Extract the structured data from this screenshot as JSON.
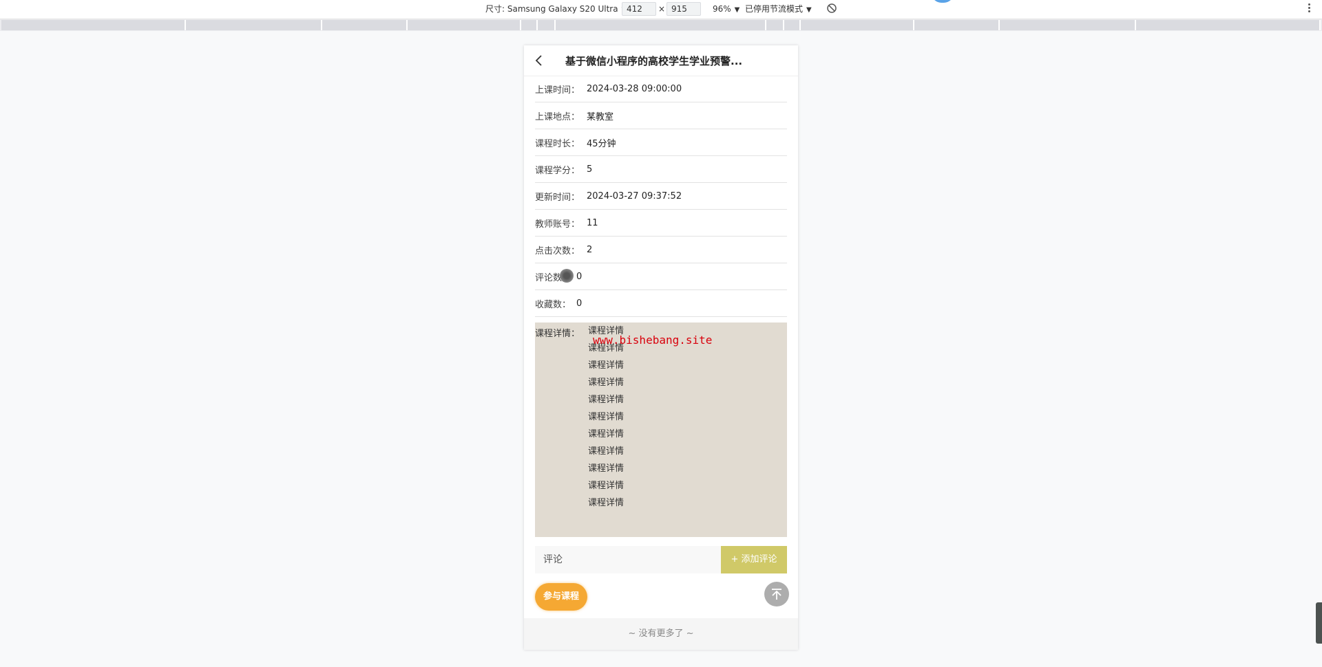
{
  "devtools": {
    "device_label": "尺寸: Samsung Galaxy S20 Ultra",
    "width_value": "412",
    "times": "×",
    "height_value": "915",
    "zoom": "96%",
    "throttle": "已停用节流模式",
    "caret": "▼"
  },
  "nav": {
    "title": "基于微信小程序的高校学生学业预警..."
  },
  "fields": [
    {
      "label": "上课时间：",
      "value": "2024-03-28 09:00:00"
    },
    {
      "label": "上课地点：",
      "value": "某教室"
    },
    {
      "label": "课程时长：",
      "value": "45分钟"
    },
    {
      "label": "课程学分：",
      "value": "5"
    },
    {
      "label": "更新时间：",
      "value": "2024-03-27 09:37:52"
    },
    {
      "label": "教师账号：",
      "value": "11"
    },
    {
      "label": "点击次数：",
      "value": "2"
    },
    {
      "label": "评论数：",
      "value": "0"
    },
    {
      "label": "收藏数：",
      "value": "0"
    }
  ],
  "detail": {
    "label": "课程详情：",
    "lines": [
      "课程详情",
      "课程详情",
      "课程详情",
      "课程详情",
      "课程详情",
      "课程详情",
      "课程详情",
      "课程详情",
      "课程详情",
      "课程详情",
      "课程详情"
    ],
    "watermark": "www.bishebang.site"
  },
  "comment": {
    "placeholder": "评论",
    "add_label": "+ 添加评论"
  },
  "join_label": "参与课程",
  "footer": "~ 没有更多了 ~",
  "colors": {
    "detail_bg": "#e1dbd1",
    "add_comment_bg": "#d0c968",
    "join_bg": "#f5a833",
    "watermark": "#d8000c"
  }
}
